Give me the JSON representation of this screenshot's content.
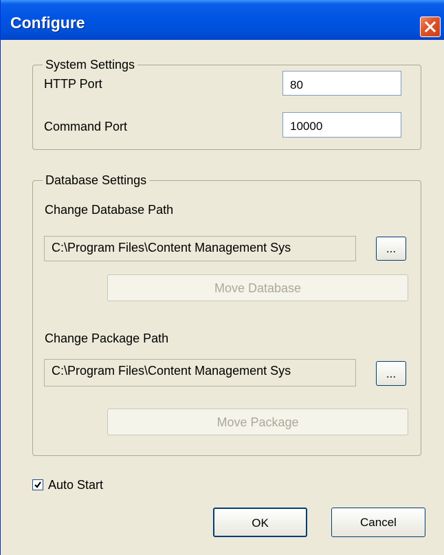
{
  "window": {
    "title": "Configure"
  },
  "system_settings": {
    "legend": "System Settings",
    "http_port_label": "HTTP Port",
    "http_port_value": "80",
    "command_port_label": "Command Port",
    "command_port_value": "10000"
  },
  "database_settings": {
    "legend": "Database Settings",
    "database_path_label": "Change Database Path",
    "database_path_value": "C:\\Program Files\\Content Management Sys",
    "browse_database_label": "...",
    "move_database_label": "Move Database",
    "package_path_label": "Change Package Path",
    "package_path_value": "C:\\Program Files\\Content Management Sys",
    "browse_package_label": "...",
    "move_package_label": "Move Package"
  },
  "auto_start": {
    "label": "Auto Start",
    "checked": true
  },
  "buttons": {
    "ok_label": "OK",
    "cancel_label": "Cancel"
  },
  "colors": {
    "titlebar": "#0054e3",
    "dialog_bg": "#ece9d8",
    "close_button": "#e0562a",
    "disabled_text": "#aca899"
  },
  "icons": {
    "close": "close-icon",
    "check": "checkmark-icon"
  }
}
